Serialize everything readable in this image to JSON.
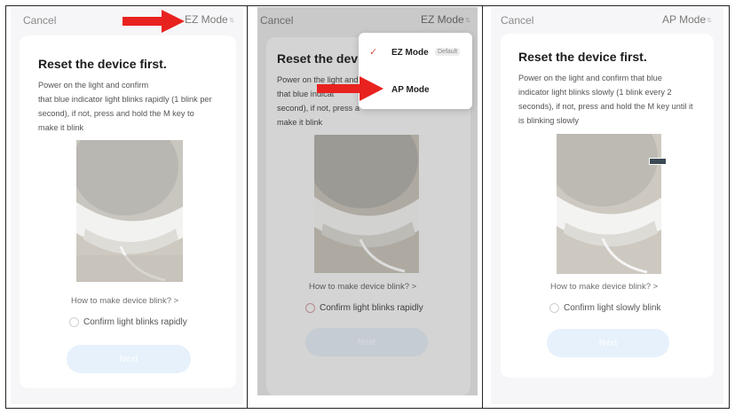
{
  "colors": {
    "arrow": "#e8221f",
    "check": "#e0574a",
    "next_bg": "#e6f1fb"
  },
  "screens": [
    {
      "cancel": "Cancel",
      "mode": "EZ Mode",
      "title": "Reset the device first.",
      "desc_lines": [
        "Power on the light and confirm",
        "that blue indicator light blinks  rapidly (1 blink per",
        "second), if not, press and hold the M key to",
        "make it blink"
      ],
      "howto": "How to make device blink? >",
      "confirm": "Confirm light blinks rapidly",
      "next": "Next"
    },
    {
      "cancel": "Cancel",
      "mode": "EZ Mode",
      "title": "Reset the device first.",
      "desc_lines": [
        "Power on the light and confirm",
        "that blue indicat",
        "second), if not, press a",
        "make it blink"
      ],
      "howto": "How to make device blink? >",
      "confirm": "Confirm light blinks rapidly",
      "next": "Next",
      "dropdown": {
        "ez_label": "EZ Mode",
        "ez_badge": "Default",
        "ap_label": "AP Mode"
      }
    },
    {
      "cancel": "Cancel",
      "mode": "AP Mode",
      "title": "Reset the device first.",
      "desc_lines": [
        "Power on the light and confirm that blue",
        "indicator light blinks  slowly (1 blink every 2",
        "seconds), if not, press and hold the M key until it",
        "is blinking slowly"
      ],
      "howto": "How to make device blink? >",
      "confirm": "Confirm light slowly blink",
      "next": "Next"
    }
  ]
}
